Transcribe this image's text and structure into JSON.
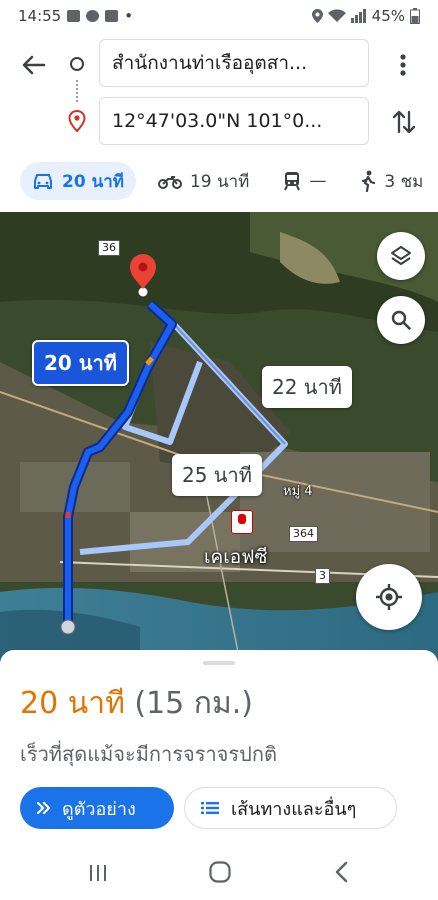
{
  "status_bar": {
    "time": "14:55",
    "dot": "•",
    "battery": "45%"
  },
  "search": {
    "origin": "สำนักงานท่าเรืออุตสา...",
    "destination": "12°47'03.0\"N 101°0..."
  },
  "modes": [
    {
      "icon": "car-icon",
      "label": "20 นาที",
      "active": true
    },
    {
      "icon": "motorcycle-icon",
      "label": "19 นาที",
      "active": false
    },
    {
      "icon": "transit-icon",
      "label": "—",
      "active": false
    },
    {
      "icon": "walk-icon",
      "label": "3 ชม",
      "active": false
    }
  ],
  "map": {
    "route_labels": {
      "primary": "20 นาที",
      "alt1": "22 นาที",
      "alt2": "25 นาที"
    },
    "place_labels": {
      "town": "เคเอฟซี",
      "village": "หมู่ 4"
    },
    "road_shields": {
      "r36": "36",
      "r364": "364",
      "r3": "3"
    }
  },
  "sheet": {
    "duration": "20 นาที",
    "distance": "(15 กม.)",
    "subtitle": "เร็วที่สุดแม้จะมีการจราจรปกติ",
    "preview_label": "ดูตัวอย่าง",
    "steps_label": "เส้นทางและอื่นๆ"
  },
  "colors": {
    "accent": "#1a73e8",
    "duration": "#e37400",
    "route_primary": "#1a56db",
    "route_alt": "#a8c7fa"
  }
}
